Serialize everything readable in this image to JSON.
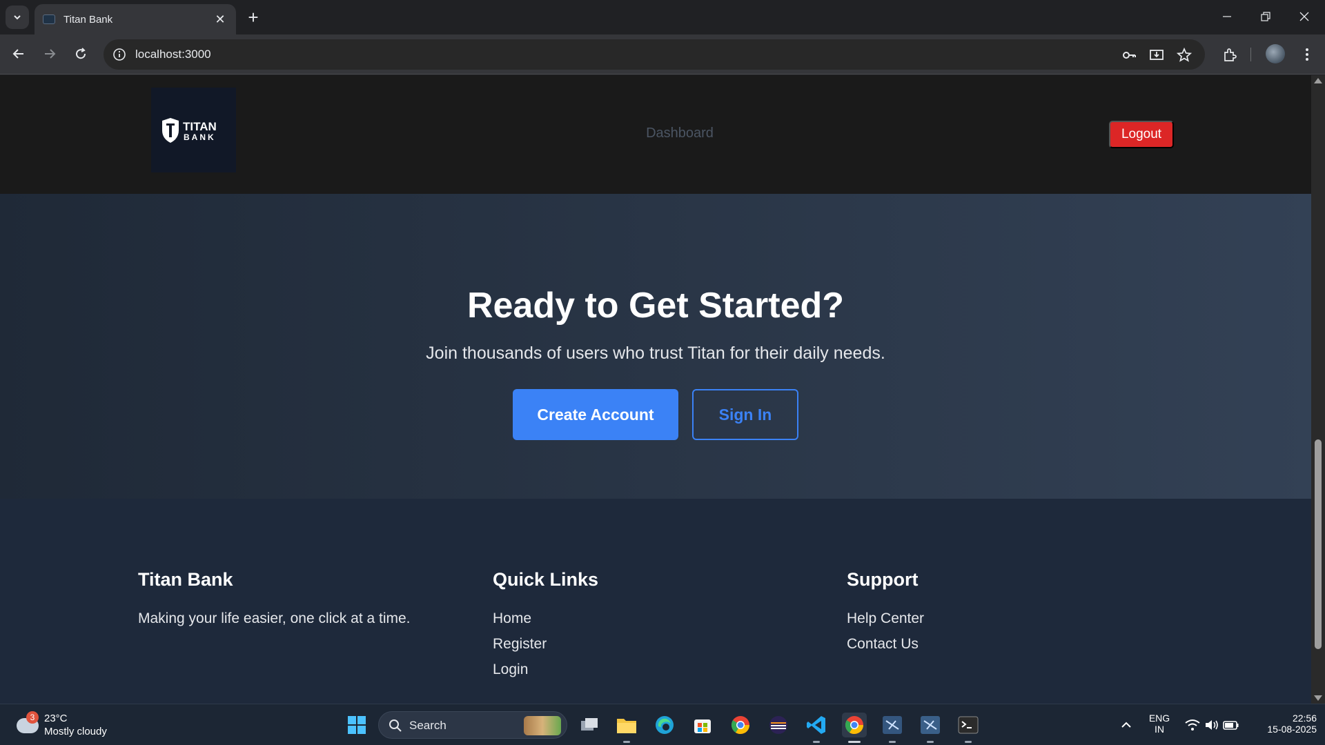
{
  "browser": {
    "tab_title": "Titan Bank",
    "url": "localhost:3000"
  },
  "header": {
    "logo_title": "TITAN",
    "logo_subtitle": "BANK",
    "nav_link": "Dashboard",
    "logout_label": "Logout"
  },
  "cta": {
    "heading": "Ready to Get Started?",
    "subheading": "Join thousands of users who trust Titan for their daily needs.",
    "create_label": "Create Account",
    "signin_label": "Sign In"
  },
  "footer": {
    "brand_title": "Titan Bank",
    "brand_tagline": "Making your life easier, one click at a time.",
    "quick_links_title": "Quick Links",
    "quick_links": [
      "Home",
      "Register",
      "Login"
    ],
    "support_title": "Support",
    "support_links": [
      "Help Center",
      "Contact Us"
    ]
  },
  "colors": {
    "header_bg": "#1a1a1a",
    "cta_bg": "#334155",
    "footer_bg": "#1e293b",
    "primary": "#3b82f6",
    "danger": "#dc2626"
  },
  "taskbar": {
    "weather_badge": "3",
    "weather_temp": "23°C",
    "weather_condition": "Mostly cloudy",
    "search_label": "Search",
    "language": "ENG",
    "region": "IN",
    "time": "22:56",
    "date": "15-08-2025",
    "icons": [
      "windows-start-icon",
      "search-icon",
      "task-view-icon",
      "file-explorer-icon",
      "edge-icon",
      "store-icon",
      "chrome-icon",
      "eclipse-icon",
      "vscode-icon",
      "chrome-active-icon",
      "app-icon",
      "app-icon",
      "terminal-icon"
    ]
  }
}
